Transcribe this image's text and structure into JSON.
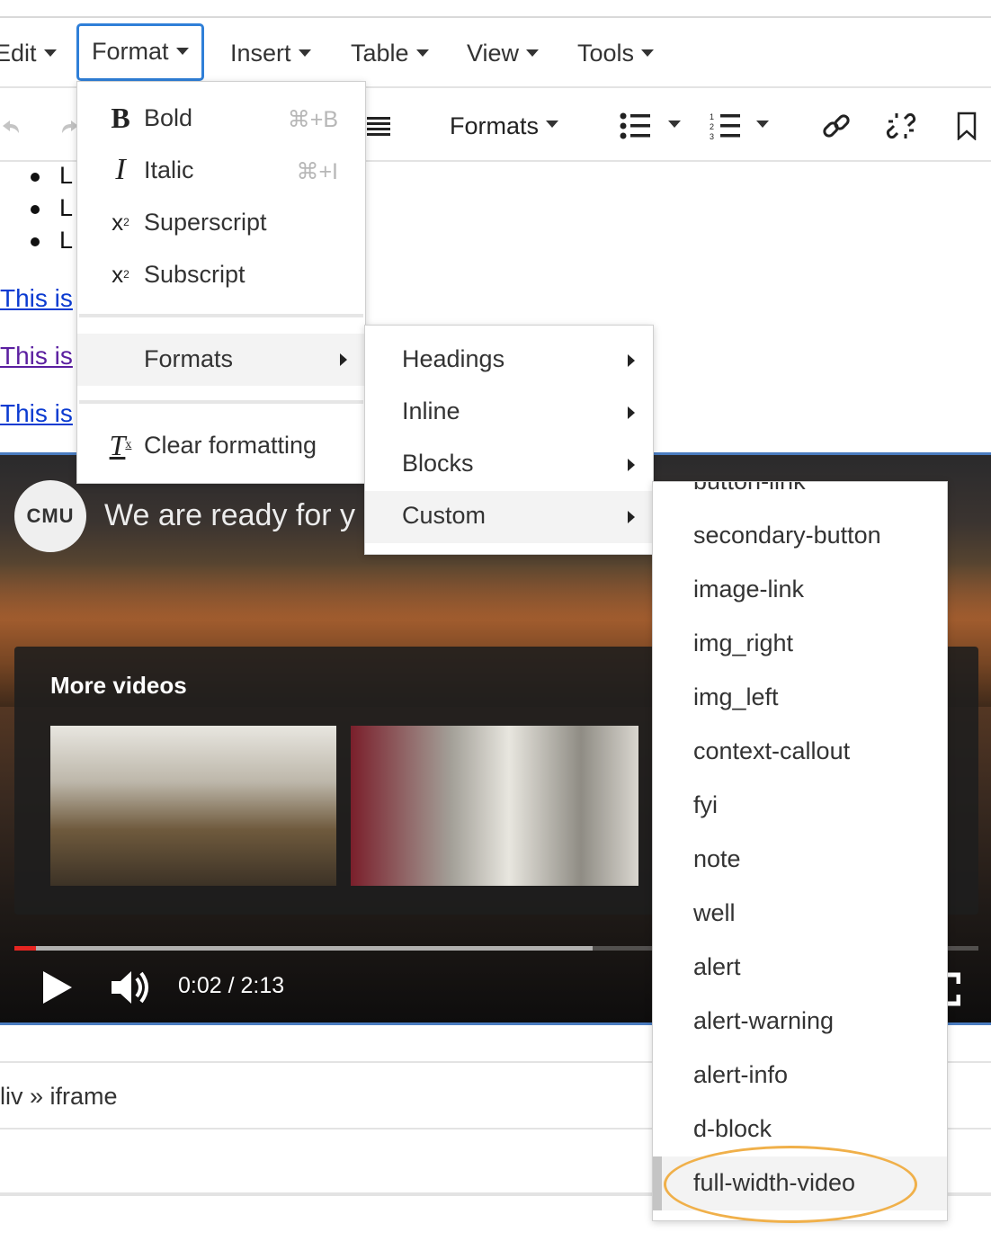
{
  "menubar": {
    "items": [
      {
        "label": "Edit"
      },
      {
        "label": "Format"
      },
      {
        "label": "Insert"
      },
      {
        "label": "Table"
      },
      {
        "label": "View"
      },
      {
        "label": "Tools"
      }
    ]
  },
  "toolbar": {
    "formats_label": "Formats"
  },
  "content": {
    "bullets": [
      "L",
      "L",
      "L"
    ],
    "links": [
      "This is",
      "This is",
      "This is"
    ],
    "link_color": "#0b3bd1",
    "visited_link_color": "#5b1fa0"
  },
  "video": {
    "channel_logo": "CMU",
    "title": "We are ready for y",
    "more_videos_label": "More videos",
    "time": "0:02 / 2:13",
    "progress_fraction": 0.015,
    "buffered_fraction": 0.6,
    "progress_color": "#e52521"
  },
  "pathbar": {
    "path": "liv » iframe"
  },
  "format_menu": {
    "items": [
      {
        "label": "Bold",
        "shortcut": "⌘+B",
        "icon": "bold-icon"
      },
      {
        "label": "Italic",
        "shortcut": "⌘+I",
        "icon": "italic-icon"
      },
      {
        "label": "Superscript",
        "shortcut": "",
        "icon": "superscript-icon"
      },
      {
        "label": "Subscript",
        "shortcut": "",
        "icon": "subscript-icon"
      }
    ],
    "formats_label": "Formats",
    "clear_label": "Clear formatting"
  },
  "formats_submenu": {
    "items": [
      "Headings",
      "Inline",
      "Blocks",
      "Custom"
    ]
  },
  "custom_submenu": {
    "items": [
      "button-link",
      "secondary-button",
      "image-link",
      "img_right",
      "img_left",
      "context-callout",
      "fyi",
      "note",
      "well",
      "alert",
      "alert-warning",
      "alert-info",
      "d-block",
      "full-width-video"
    ],
    "highlight_color": "#f0b04a"
  }
}
